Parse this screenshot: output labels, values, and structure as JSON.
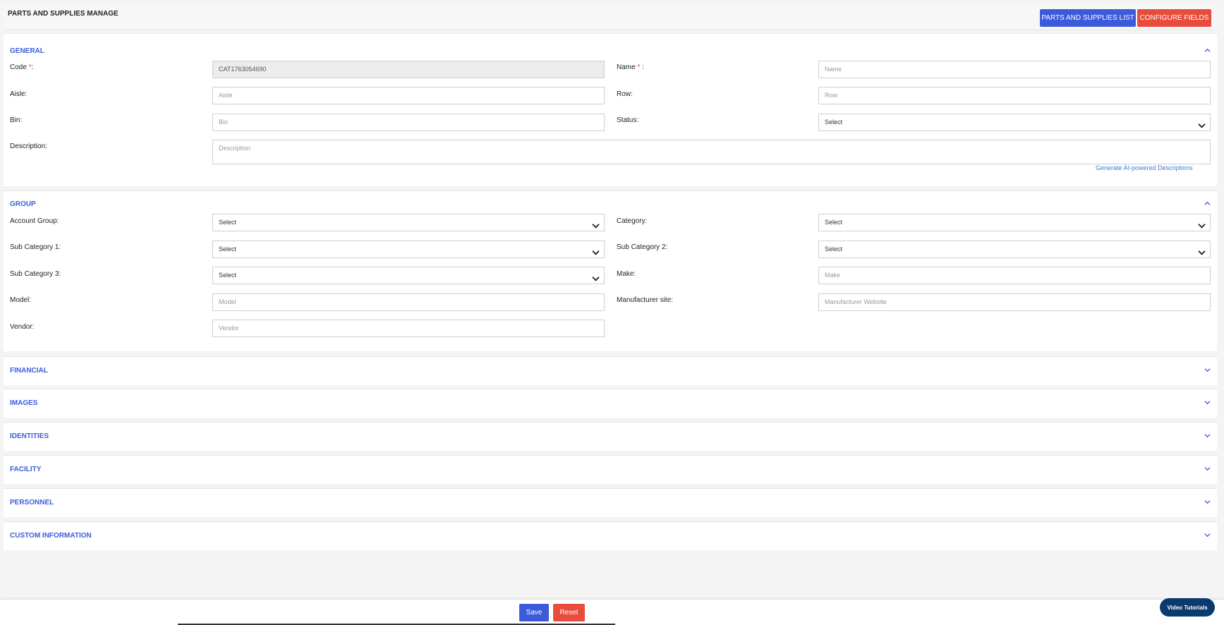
{
  "header": {
    "title": "PARTS AND SUPPLIES MANAGE",
    "list_button": "PARTS AND SUPPLIES LIST",
    "configure_button": "CONFIGURE FIELDS"
  },
  "general": {
    "title": "GENERAL",
    "code_label": "Code",
    "code_value": "CAT1763054690",
    "name_label": "Name",
    "name_placeholder": "Name",
    "aisle_label": "Aisle:",
    "aisle_placeholder": "Aisle",
    "row_label": "Row:",
    "row_placeholder": "Row",
    "bin_label": "Bin:",
    "bin_placeholder": "Bin",
    "status_label": "Status:",
    "status_value": "Select",
    "description_label": "Description:",
    "description_placeholder": "Description",
    "ai_link": "Generate AI-powered Descriptions"
  },
  "group": {
    "title": "GROUP",
    "account_group_label": "Account Group:",
    "account_group_value": "Select",
    "category_label": "Category:",
    "category_value": "Select",
    "sub1_label": "Sub Category 1:",
    "sub1_value": "Select",
    "sub2_label": "Sub Category 2:",
    "sub2_value": "Select",
    "sub3_label": "Sub Category 3:",
    "sub3_value": "Select",
    "make_label": "Make:",
    "make_placeholder": "Make",
    "model_label": "Model:",
    "model_placeholder": "Model",
    "manufacturer_label": "Manufacturer site:",
    "manufacturer_placeholder": "Manufacturer Website",
    "vendor_label": "Vendor:",
    "vendor_placeholder": "Vendor"
  },
  "collapsed_sections": [
    "FINANCIAL",
    "IMAGES",
    "IDENTITIES",
    "FACILITY",
    "PERSONNEL",
    "CUSTOM INFORMATION"
  ],
  "footer": {
    "save": "Save",
    "reset": "Reset",
    "video": "Video Tutorials"
  },
  "colors": {
    "primary": "#3b5bdb",
    "danger": "#e74c3c",
    "video": "#0b3a6e"
  }
}
